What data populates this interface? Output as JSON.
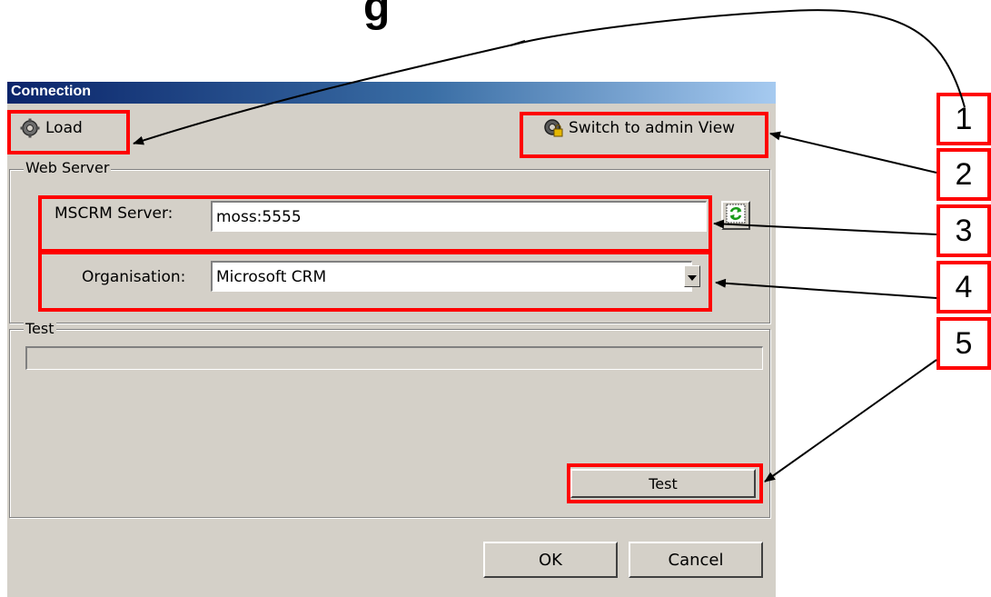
{
  "slide": {
    "title_fragment": "g"
  },
  "dialog": {
    "title": "Connection",
    "toolbar": {
      "load_label": "Load",
      "switch_label": "Switch to admin View"
    },
    "web_server": {
      "group_label": "Web Server",
      "server_label": "MSCRM Server:",
      "server_value": "moss:5555",
      "organisation_label": "Organisation:",
      "organisation_value": "Microsoft CRM"
    },
    "test": {
      "group_label": "Test",
      "progress": 0,
      "test_button_label": "Test"
    },
    "buttons": {
      "ok_label": "OK",
      "cancel_label": "Cancel"
    }
  },
  "callouts": [
    "1",
    "2",
    "3",
    "4",
    "5"
  ],
  "colors": {
    "highlight": "#ff0000",
    "dialog_bg": "#d4d0c8",
    "title_start": "#0a246a",
    "title_end": "#a6caf0"
  }
}
